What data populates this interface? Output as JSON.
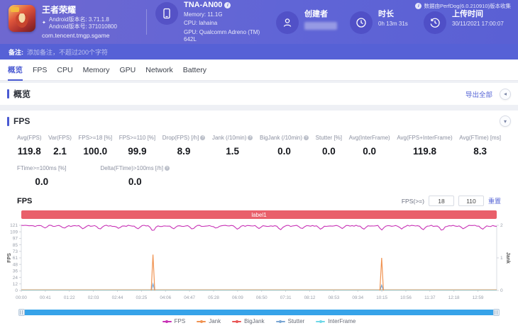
{
  "header": {
    "app": {
      "name": "王者荣耀",
      "version_name": "Android版本名: 3.71.1.8",
      "version_code": "Android版本号: 371010800",
      "package": "com.tencent.tmgp.sgame"
    },
    "device": {
      "model": "TNA-AN00",
      "memory": "Memory: 11.1G",
      "cpu": "CPU: lahaina",
      "gpu": "GPU: Qualcomm Adreno (TM) 642L"
    },
    "creator": {
      "label": "创建者"
    },
    "duration": {
      "label": "时长",
      "value": "0h 13m 31s"
    },
    "upload": {
      "label": "上传时间",
      "value": "30/11/2021 17:00:07"
    },
    "collector_note": "数据由PerfDog(6.0.210910)版本收集"
  },
  "remark": {
    "label": "备注:",
    "placeholder": "添加备注，不超过200个字符"
  },
  "tabs": [
    {
      "label": "概览",
      "active": true
    },
    {
      "label": "FPS"
    },
    {
      "label": "CPU"
    },
    {
      "label": "Memory"
    },
    {
      "label": "GPU"
    },
    {
      "label": "Network"
    },
    {
      "label": "Battery"
    }
  ],
  "overview": {
    "title": "概览",
    "export_label": "导出全部"
  },
  "icons": {
    "overview_collapse": "◂",
    "fps_collapse": "▾"
  },
  "fps": {
    "title": "FPS",
    "metrics_row1": [
      {
        "label": "Avg(FPS)",
        "value": "119.8"
      },
      {
        "label": "Var(FPS)",
        "value": "2.1"
      },
      {
        "label": "FPS>=18 [%]",
        "value": "100.0"
      },
      {
        "label": "FPS>=110 [%]",
        "value": "99.9"
      },
      {
        "label": "Drop(FPS) [/h]",
        "value": "8.9",
        "info": true
      },
      {
        "label": "Jank (/10min)",
        "value": "1.5",
        "info": true
      },
      {
        "label": "BigJank (/10min)",
        "value": "0.0",
        "info": true
      },
      {
        "label": "Stutter [%]",
        "value": "0.0"
      },
      {
        "label": "Avg(InterFrame)",
        "value": "0.0"
      },
      {
        "label": "Avg(FPS+InterFrame)",
        "value": "119.8"
      },
      {
        "label": "Avg(FTime) [ms]",
        "value": "8.3"
      }
    ],
    "metrics_row2": [
      {
        "label": "FTime>=100ms [%]",
        "value": "0.0"
      },
      {
        "label": "Delta(FTime)>100ms [/h]",
        "value": "0.0",
        "info": true
      }
    ],
    "chart_header": {
      "title": "FPS",
      "filter_label": "FPS(>=)",
      "input1": "18",
      "input2": "110",
      "reset_label": "重置"
    },
    "label_bar": "label1"
  },
  "chart_data": {
    "type": "line",
    "title": "FPS",
    "duration_s": 811,
    "x_tick_interval_s": 41,
    "x_ticks": [
      "00:00",
      "00:41",
      "01:22",
      "02:03",
      "02:44",
      "03:25",
      "04:06",
      "04:47",
      "05:28",
      "06:09",
      "06:50",
      "07:31",
      "08:12",
      "08:53",
      "09:34",
      "10:15",
      "10:56",
      "11:37",
      "12:18",
      "12:59"
    ],
    "left_axis": {
      "label": "FPS",
      "ticks": [
        0,
        12,
        24,
        36,
        48,
        61,
        73,
        85,
        97,
        109,
        121
      ],
      "max": 121
    },
    "right_axis": {
      "label": "Jank",
      "ticks": [
        0,
        1,
        2
      ],
      "max": 2
    },
    "series": [
      {
        "name": "FPS",
        "color": "#c832b6",
        "baseline": 119.8,
        "dips": [
          [
            0.05,
            116
          ],
          [
            0.09,
            115
          ],
          [
            0.13,
            114
          ],
          [
            0.165,
            113
          ],
          [
            0.205,
            115
          ],
          [
            0.245,
            114
          ],
          [
            0.277,
            109
          ],
          [
            0.32,
            114
          ],
          [
            0.36,
            113
          ],
          [
            0.41,
            115
          ],
          [
            0.455,
            113
          ],
          [
            0.5,
            115
          ],
          [
            0.545,
            112
          ],
          [
            0.59,
            114
          ],
          [
            0.63,
            113
          ],
          [
            0.675,
            115
          ],
          [
            0.72,
            113
          ],
          [
            0.758,
            112
          ],
          [
            0.8,
            114
          ],
          [
            0.845,
            112
          ],
          [
            0.885,
            110
          ],
          [
            0.93,
            114
          ],
          [
            0.97,
            113
          ]
        ]
      },
      {
        "name": "Jank",
        "color": "#f09352",
        "spikes": [
          [
            0.277,
            1.1
          ],
          [
            0.758,
            1.0
          ]
        ]
      },
      {
        "name": "BigJank",
        "color": "#e85656",
        "baseline": 0
      },
      {
        "name": "Stutter",
        "color": "#7ba7d4",
        "spikes": [
          [
            0.277,
            0.2
          ],
          [
            0.758,
            0.16
          ]
        ]
      },
      {
        "name": "InterFrame",
        "color": "#6fd8e8",
        "baseline": 0
      }
    ],
    "legend": [
      {
        "label": "FPS",
        "color": "#c832b6"
      },
      {
        "label": "Jank",
        "color": "#f09352"
      },
      {
        "label": "BigJank",
        "color": "#e85656"
      },
      {
        "label": "Stutter",
        "color": "#7ba7d4"
      },
      {
        "label": "InterFrame",
        "color": "#6fd8e8"
      }
    ]
  },
  "colors": {
    "accent": "#4a5ad2",
    "label_bar": "#e95f6a",
    "scrollbar": "#36a3e9"
  }
}
